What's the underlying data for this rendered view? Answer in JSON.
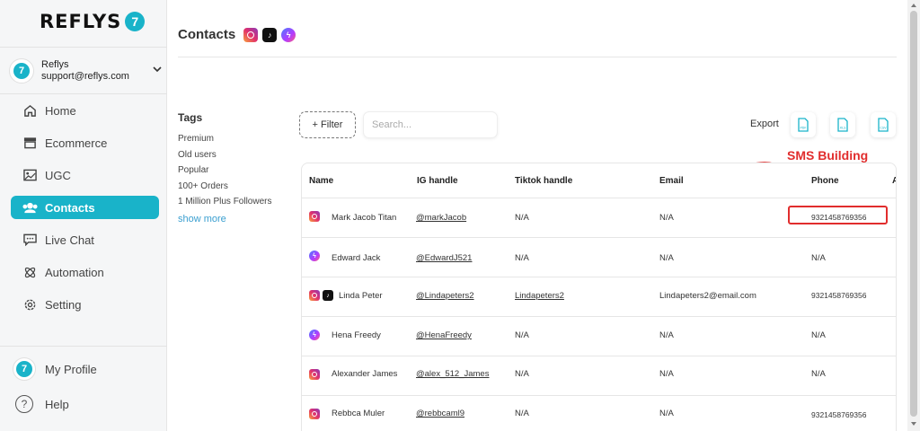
{
  "brand": {
    "logo_text": "REFLYS"
  },
  "account": {
    "name": "Reflys",
    "email": "support@reflys.com"
  },
  "sidebar": {
    "items": [
      {
        "label": "Home",
        "icon": "home-icon"
      },
      {
        "label": "Ecommerce",
        "icon": "store-icon"
      },
      {
        "label": "UGC",
        "icon": "image-icon"
      },
      {
        "label": "Contacts",
        "icon": "users-icon",
        "active": true
      },
      {
        "label": "Live Chat",
        "icon": "chat-icon"
      },
      {
        "label": "Automation",
        "icon": "atom-icon"
      },
      {
        "label": "Setting",
        "icon": "gear-icon"
      }
    ],
    "my_profile": "My Profile",
    "help": "Help"
  },
  "header": {
    "title": "Contacts"
  },
  "tags": {
    "title": "Tags",
    "items": [
      "Premium",
      "Old users",
      "Popular",
      "100+ Orders",
      "1 Million Plus Followers"
    ],
    "show_more": "show more"
  },
  "toolbar": {
    "filter_label": "+ Filter",
    "search_placeholder": "Search...",
    "export_label": "Export",
    "export_formats": [
      "PDF",
      "XLS",
      "CSV"
    ]
  },
  "annotation": {
    "text": "SMS Building",
    "color": "#e12d2d"
  },
  "table": {
    "columns": [
      "Name",
      "IG handle",
      "Tiktok handle",
      "Email",
      "Phone",
      "A"
    ],
    "rows": [
      {
        "channels": [
          "instagram"
        ],
        "name": "Mark Jacob Titan",
        "ig": "@markJacob",
        "tiktok": "N/A",
        "email": "N/A",
        "phone": "9321458769356"
      },
      {
        "channels": [
          "messenger"
        ],
        "name": "Edward Jack",
        "ig": "@EdwardJ521",
        "tiktok": "N/A",
        "email": "N/A",
        "phone": "N/A"
      },
      {
        "channels": [
          "instagram",
          "tiktok"
        ],
        "name": "Linda Peter",
        "ig": "@Lindapeters2",
        "tiktok": "Lindapeters2",
        "email": "Lindapeters2@email.com",
        "phone": "9321458769356"
      },
      {
        "channels": [
          "messenger"
        ],
        "name": "Hena Freedy",
        "ig": "@HenaFreedy",
        "tiktok": "N/A",
        "email": "N/A",
        "phone": "N/A"
      },
      {
        "channels": [
          "instagram"
        ],
        "name": "Alexander James",
        "ig": "@alex_512_James",
        "tiktok": "N/A",
        "email": "N/A",
        "phone": "N/A"
      },
      {
        "channels": [
          "instagram"
        ],
        "name": "Rebbca Muler",
        "ig": "@rebbcaml9",
        "tiktok": "N/A",
        "email": "N/A",
        "phone": "9321458769356"
      }
    ]
  },
  "colors": {
    "accent": "#19b3c9",
    "annotation": "#e12d2d"
  }
}
